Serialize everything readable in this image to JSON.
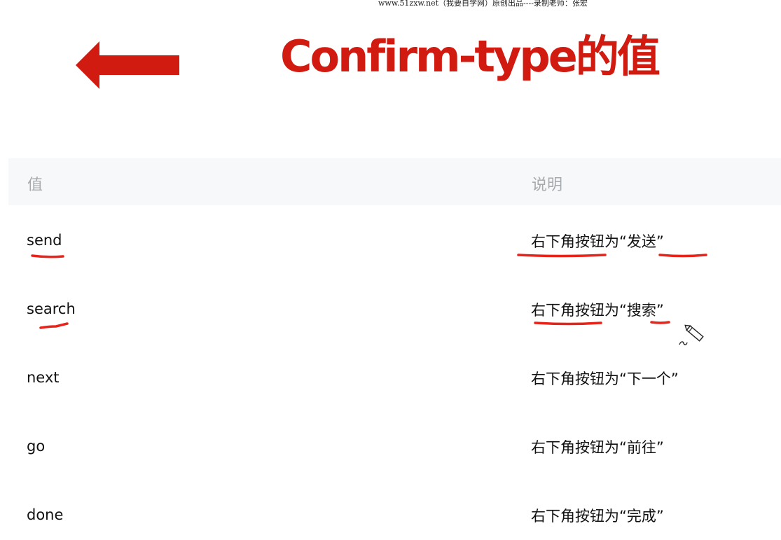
{
  "watermark": "www.51zxw.net（我要自学网）原创出品----录制老师：张宏",
  "title": "Confirm-type的值",
  "icons": {
    "back_arrow": "left-arrow-icon",
    "cursor": "pencil-cursor-icon"
  },
  "colors": {
    "accent": "#d11a10",
    "header_bg": "#f7f8f9",
    "header_text": "#a7aaad"
  },
  "table": {
    "headers": [
      "值",
      "说明"
    ],
    "rows": [
      {
        "value": "send",
        "desc": "右下角按钮为“发送”"
      },
      {
        "value": "search",
        "desc": "右下角按钮为“搜索”"
      },
      {
        "value": "next",
        "desc": "右下角按钮为“下一个”"
      },
      {
        "value": "go",
        "desc": "右下角按钮为“前往”"
      },
      {
        "value": "done",
        "desc": "右下角按钮为“完成”"
      }
    ]
  }
}
